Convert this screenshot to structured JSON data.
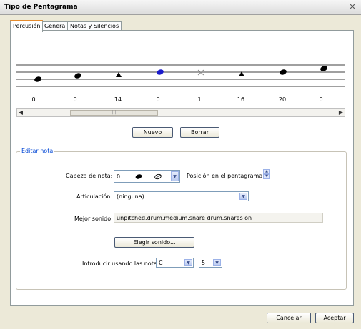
{
  "window": {
    "title": "Tipo de Pentagrama",
    "close_glyph": "✕"
  },
  "tabs": [
    {
      "label": "Percusión"
    },
    {
      "label": "General"
    },
    {
      "label": "Notas y Silencios"
    }
  ],
  "staff": {
    "values": [
      "0",
      "0",
      "14",
      "0",
      "1",
      "16",
      "20",
      "0"
    ],
    "noteheads": [
      "oval-filled",
      "oval-filled",
      "triangle",
      "oval-blue",
      "x",
      "triangle",
      "oval-filled",
      "oval-filled"
    ],
    "accent_color": "#1a1acc"
  },
  "scroll": {
    "left_arrow": "◀",
    "right_arrow": "▶",
    "thumb_grip": "|||"
  },
  "buttons": {
    "nuevo": "Nuevo",
    "borrar": "Borrar"
  },
  "edit": {
    "legend": "Editar nota",
    "notehead_label": "Cabeza de nota:",
    "notehead_value": "0",
    "position_label": "Posición en el pentagrama:",
    "articulation_label": "Articulación:",
    "articulation_value": "(ninguna)",
    "best_sound_label": "Mejor sonido:",
    "best_sound_value": "unpitched.drum.medium.snare drum.snares on",
    "choose_sound": "Elegir sonido...",
    "input_label": "Introducir usando las notas",
    "note_value": "C",
    "octave_value": "5"
  },
  "footer": {
    "cancel": "Cancelar",
    "accept": "Aceptar"
  },
  "icons": {
    "dropdown": "▼",
    "spin_up": "▲",
    "spin_down": "▼"
  }
}
